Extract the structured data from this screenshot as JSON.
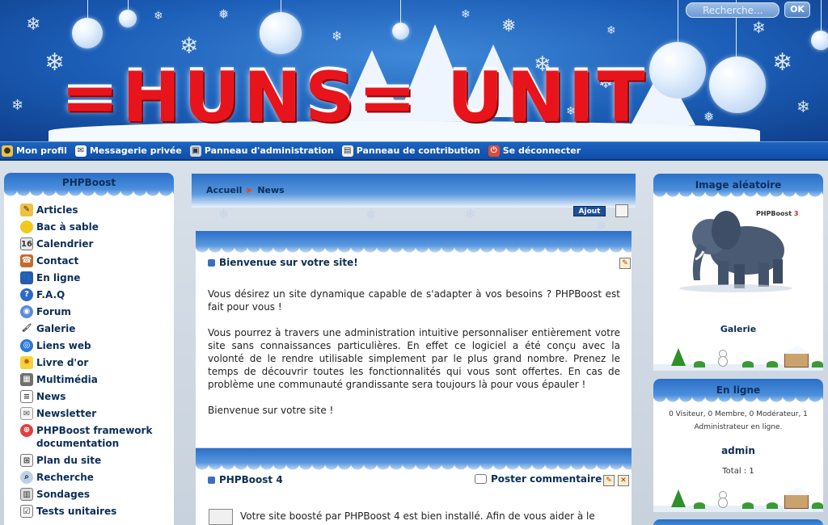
{
  "header": {
    "logo_text": "=HUNS= UNIT",
    "search_placeholder": "Recherche...",
    "search_button": "OK"
  },
  "topmenu": {
    "items": [
      {
        "label": "Mon profil",
        "icon": "bulb-icon"
      },
      {
        "label": "Messagerie privée",
        "icon": "envelope-icon"
      },
      {
        "label": "Panneau d'administration",
        "icon": "admin-icon"
      },
      {
        "label": "Panneau de contribution",
        "icon": "contribution-icon"
      },
      {
        "label": "Se déconnecter",
        "icon": "logout-icon"
      }
    ]
  },
  "left_menu": {
    "title": "PHPBoost",
    "items": [
      {
        "label": "Articles",
        "icon": "articles-icon"
      },
      {
        "label": "Bac à sable",
        "icon": "sandbox-icon"
      },
      {
        "label": "Calendrier",
        "icon": "calendar-icon"
      },
      {
        "label": "Contact",
        "icon": "contact-icon"
      },
      {
        "label": "En ligne",
        "icon": "online-icon"
      },
      {
        "label": "F.A.Q",
        "icon": "faq-icon"
      },
      {
        "label": "Forum",
        "icon": "forum-icon"
      },
      {
        "label": "Galerie",
        "icon": "gallery-icon"
      },
      {
        "label": "Liens web",
        "icon": "weblinks-icon"
      },
      {
        "label": "Livre d'or",
        "icon": "guestbook-icon"
      },
      {
        "label": "Multimédia",
        "icon": "multimedia-icon"
      },
      {
        "label": "News",
        "icon": "news-icon"
      },
      {
        "label": "Newsletter",
        "icon": "newsletter-icon"
      },
      {
        "label": "PHPBoost framework documentation",
        "icon": "doc-icon"
      },
      {
        "label": "Plan du site",
        "icon": "sitemap-icon"
      },
      {
        "label": "Recherche",
        "icon": "search-icon"
      },
      {
        "label": "Sondages",
        "icon": "polls-icon"
      },
      {
        "label": "Tests unitaires",
        "icon": "tests-icon"
      }
    ]
  },
  "breadcrumb": {
    "home": "Accueil",
    "current": "News"
  },
  "actions": {
    "add_label": "Ajout"
  },
  "news": [
    {
      "title": "Bienvenue sur votre site!",
      "paragraphs": [
        "Vous désirez un site dynamique capable de s'adapter à vos besoins ? PHPBoost est fait pour vous !",
        "Vous pourrez à travers une administration intuitive personnaliser entièrement votre site sans connaissances particulières. En effet ce logiciel a été conçu avec la volonté de le rendre utilisable simplement par le plus grand nombre. Prenez le temps de découvrir toutes les fonctionnalités qui vous sont offertes. En cas de problème une communauté grandissante sera toujours là pour vous épauler !",
        "Bienvenue sur votre site !"
      ]
    },
    {
      "title": "PHPBoost 4",
      "comment_label": "Poster commentaire",
      "body": "Votre site boosté par PHPBoost 4 est bien installé. Afin de vous aider à le"
    }
  ],
  "right": {
    "image_title": "Image aléatoire",
    "image_brand": "PHPBoost",
    "image_brand_version": "3",
    "gallery_label": "Galerie",
    "online_title": "En ligne",
    "online_text": "0 Visiteur, 0 Membre, 0 Modérateur, 1 Administrateur en ligne.",
    "online_user": "admin",
    "online_total": "Total : 1"
  },
  "colors": {
    "header_blue": "#1c5fb8",
    "menu_bar": "#1e64c0",
    "logo_red": "#e8141c",
    "link_navy": "#0c2e58"
  }
}
